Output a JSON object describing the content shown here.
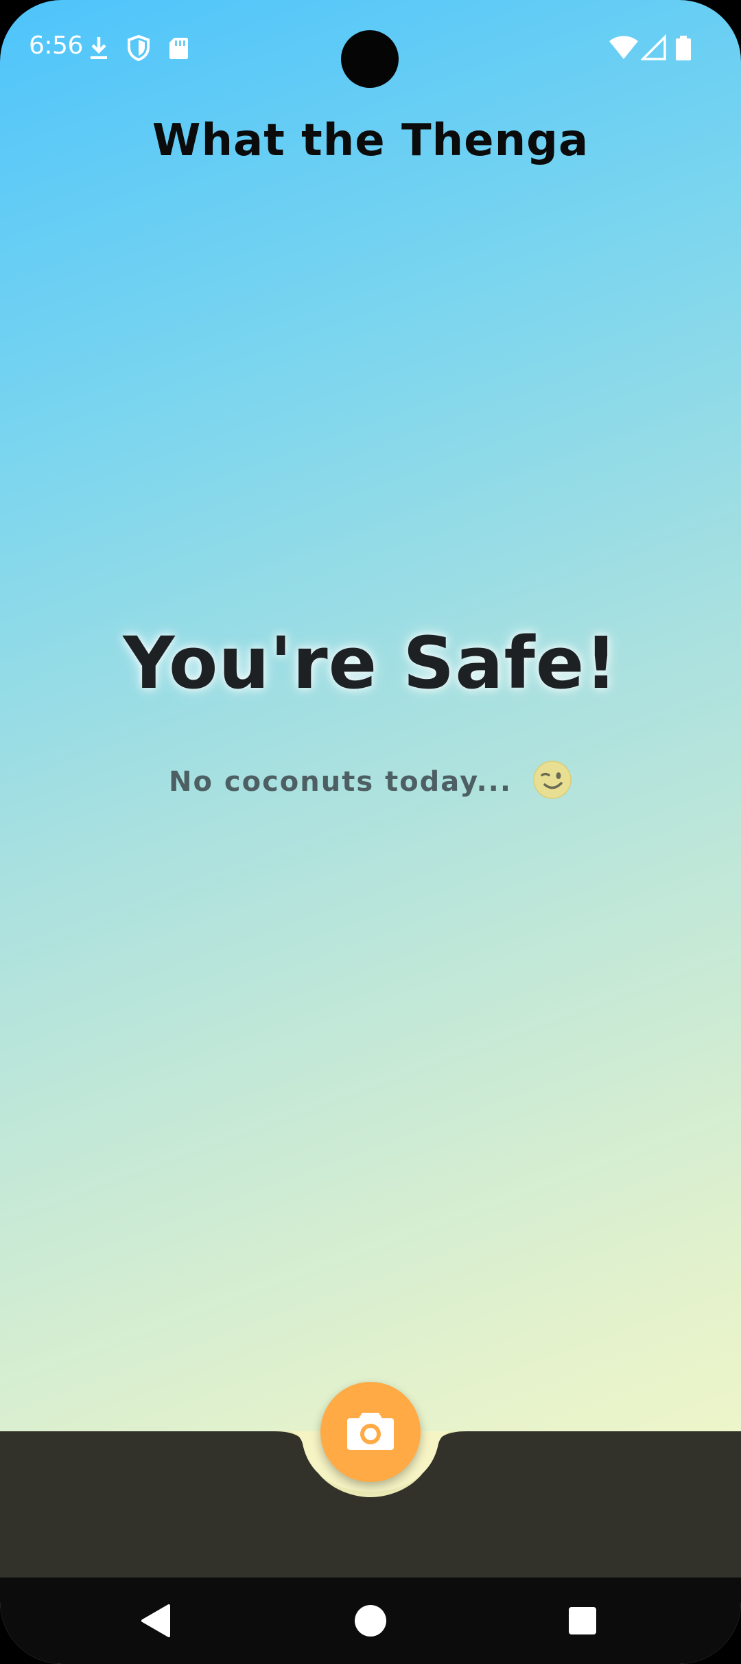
{
  "status_bar": {
    "time": "6:56",
    "left_icons": [
      "download-icon",
      "shield-icon",
      "sd-card-icon"
    ],
    "right_icons": [
      "wifi-icon",
      "cell-signal-icon",
      "battery-icon"
    ]
  },
  "app": {
    "title": "What the Thenga"
  },
  "main": {
    "headline": "You're Safe!",
    "subline": "No coconuts today...",
    "emoji": "winking-face-icon"
  },
  "fab": {
    "icon": "camera-icon",
    "color": "#ffaa45"
  },
  "nav": {
    "buttons": [
      "back-icon",
      "home-icon",
      "recents-icon"
    ]
  },
  "colors": {
    "gradient_top": "#4ec4fb",
    "gradient_bottom": "#fbf9c6",
    "bottom_bar": "#33322a",
    "accent": "#ffaa45"
  }
}
